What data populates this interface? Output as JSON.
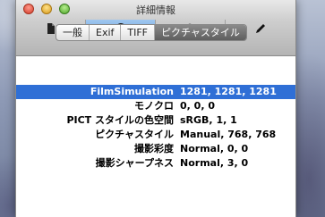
{
  "window": {
    "title": "詳細情報"
  },
  "toolbar": {
    "buttons": [
      {
        "icon": "document-icon",
        "glyph": "▤"
      },
      {
        "icon": "info-icon",
        "glyph": "i"
      },
      {
        "icon": "search-icon",
        "glyph": "⌕"
      },
      {
        "icon": "pen-icon",
        "glyph": "✎"
      }
    ]
  },
  "tabs": {
    "items": [
      "一般",
      "Exif",
      "TIFF",
      "ピクチャスタイル"
    ],
    "selected": "ピクチャスタイル"
  },
  "rows": [
    {
      "key": "FilmSimulation",
      "value": "1281, 1281, 1281",
      "selected": true
    },
    {
      "key": "モノクロ",
      "value": "0, 0, 0"
    },
    {
      "key": "PICT スタイルの色空間",
      "value": "sRGB, 1, 1"
    },
    {
      "key": "ピクチャスタイル",
      "value": "Manual, 768, 768"
    },
    {
      "key": "撮影彩度",
      "value": "Normal, 0, 0"
    },
    {
      "key": "撮影シャープネス",
      "value": "Normal, 3, 0"
    }
  ],
  "colors": {
    "selection": "#2f6fd6",
    "active_toolbar": "#7fb3e8"
  }
}
